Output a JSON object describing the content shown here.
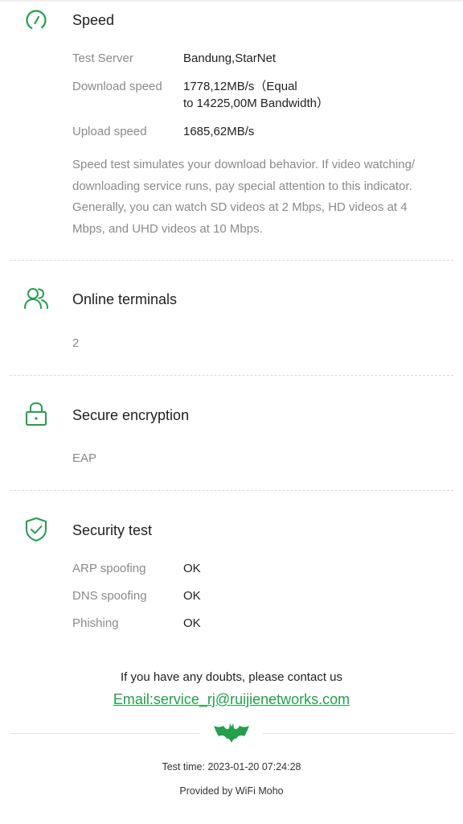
{
  "speed": {
    "title": "Speed",
    "icon": "speed-gauge-icon",
    "rows": [
      {
        "label": "Test Server",
        "value": "Bandung,StarNet"
      },
      {
        "label": "Download speed",
        "value_line1": "1778,12MB/s（Equal",
        "value_line2": "to 14225,00M Bandwidth）"
      },
      {
        "label": "Upload speed",
        "value": "1685,62MB/s"
      }
    ],
    "description_lines": [
      "Speed test simulates your download behavior. If video watching/",
      "downloading service runs, pay special attention to this indicator.",
      "Generally, you can watch SD videos at 2 Mbps, HD videos at 4",
      "Mbps, and UHD videos at 10 Mbps."
    ]
  },
  "terminals": {
    "title": "Online terminals",
    "icon": "users-icon",
    "value": "2"
  },
  "encryption": {
    "title": "Secure encryption",
    "icon": "lock-icon",
    "value": "EAP"
  },
  "security": {
    "title": "Security test",
    "icon": "shield-check-icon",
    "rows": [
      {
        "label": "ARP spoofing",
        "value": "OK"
      },
      {
        "label": "DNS spoofing",
        "value": "OK"
      },
      {
        "label": "Phishing",
        "value": "OK"
      }
    ]
  },
  "contact": {
    "text": "If you have any doubts, please contact us",
    "email": "Email:service_rj@ruijienetworks.com"
  },
  "footer": {
    "logo_icon": "bat-logo-icon",
    "test_time": "Test time: 2023-01-20 07:24:28",
    "provided_by": "Provided by WiFi Moho"
  },
  "colors": {
    "accent": "#22a04b",
    "label": "#8a8a8a",
    "text": "#1f1f1f"
  }
}
